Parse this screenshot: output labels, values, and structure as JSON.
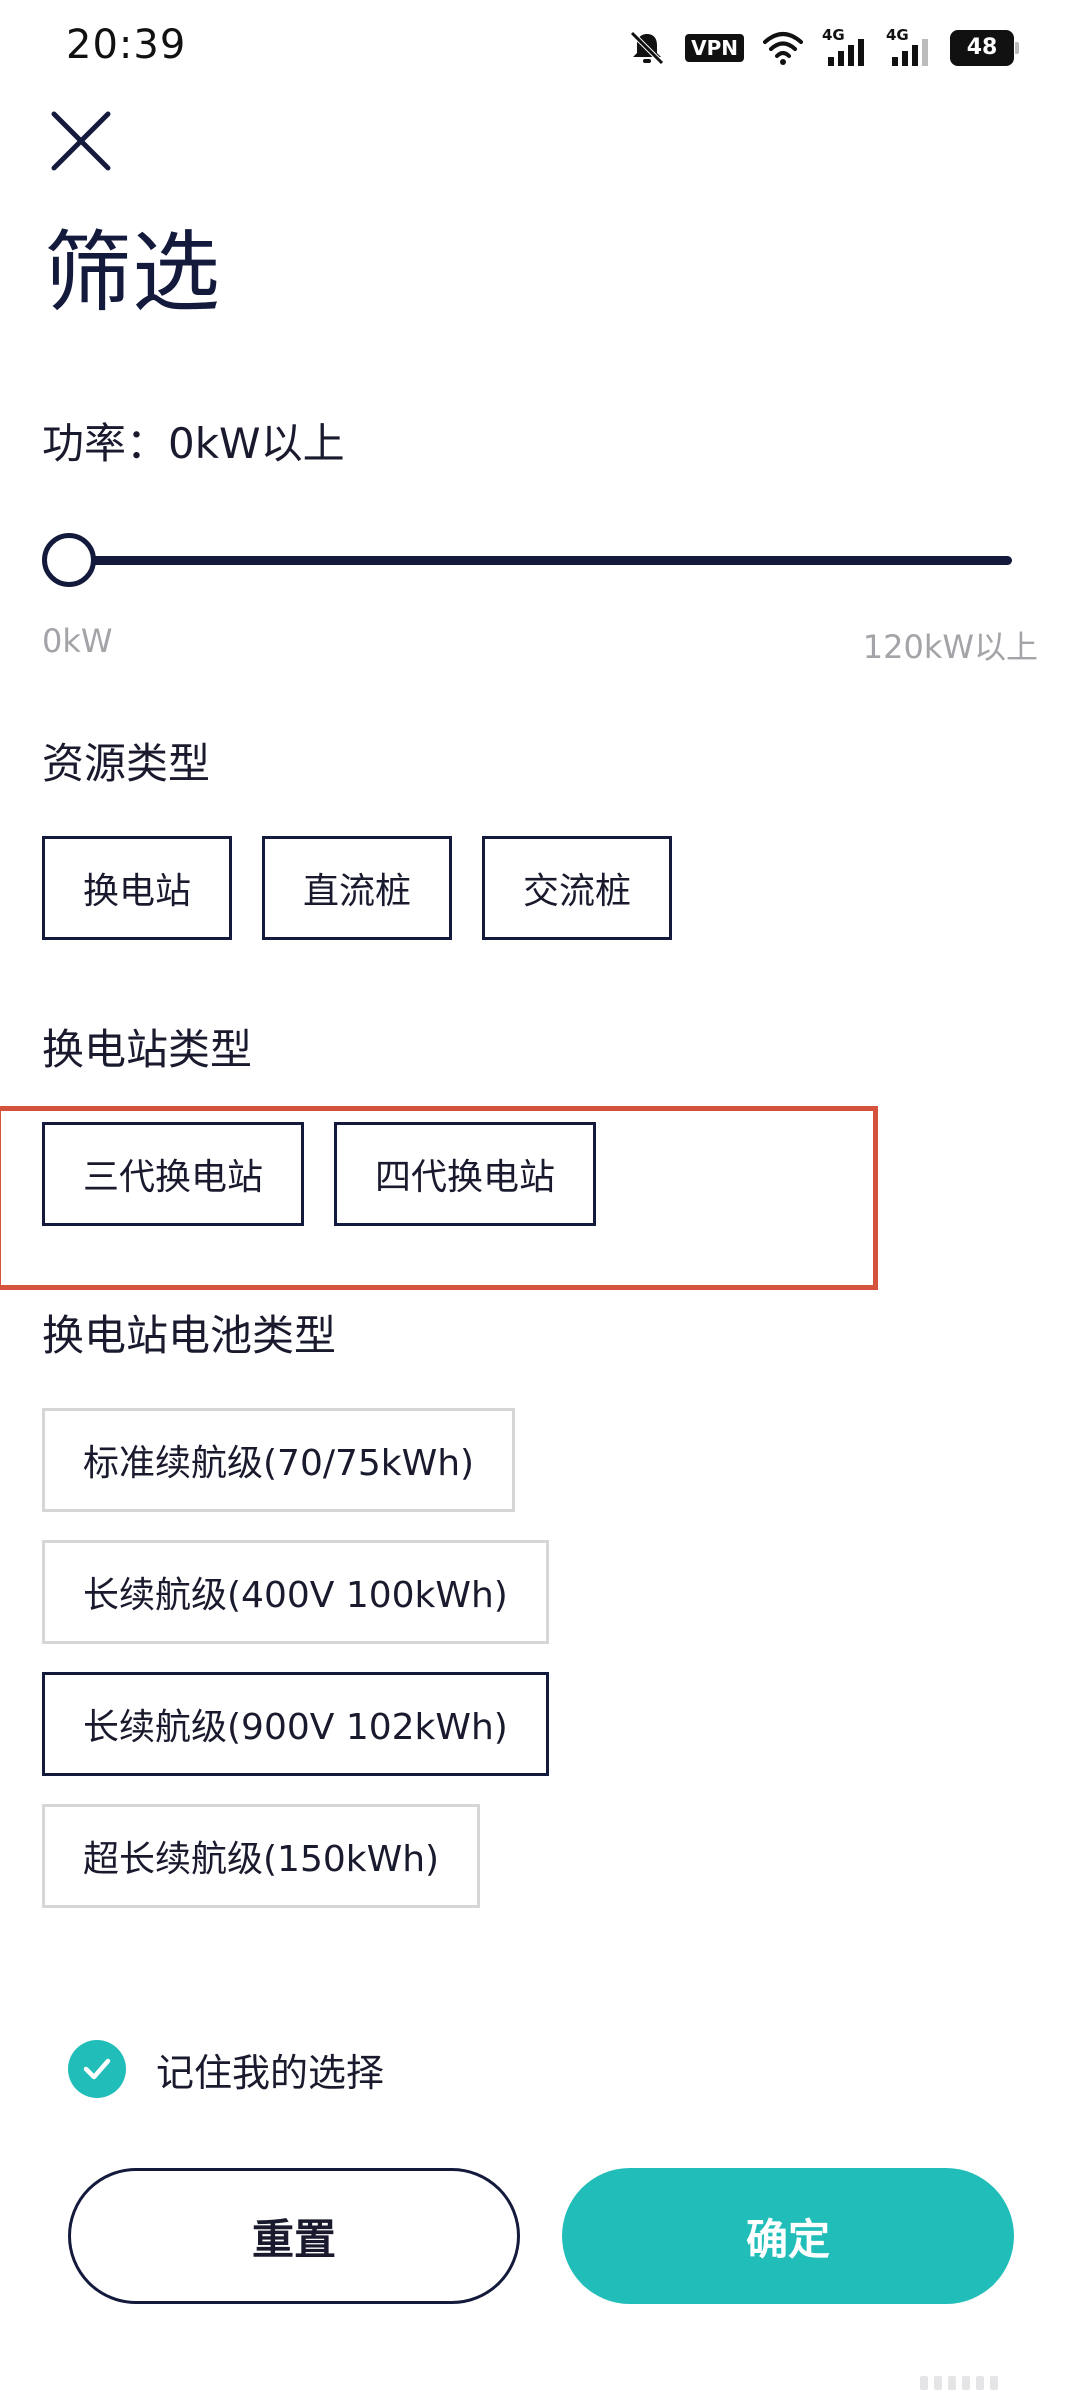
{
  "status_bar": {
    "time": "20:39",
    "icons": [
      "mute-icon",
      "vpn-icon",
      "wifi-icon",
      "signal-4g-icon",
      "signal-4g-icon",
      "battery-icon"
    ],
    "vpn_label": "VPN",
    "network_1": "4G",
    "network_2": "4G",
    "battery_level": "48"
  },
  "header": {
    "close_icon": "close-icon",
    "title": "筛选"
  },
  "power": {
    "label": "功率：0kW以上",
    "slider_value_kw": 0,
    "range_min": "0kW",
    "range_max": "120kW以上"
  },
  "resource_type": {
    "title": "资源类型",
    "options": [
      "换电站",
      "直流桩",
      "交流桩"
    ]
  },
  "station_type": {
    "title": "换电站类型",
    "options": [
      "三代换电站",
      "四代换电站"
    ],
    "highlight_color": "#d5523c"
  },
  "battery_type": {
    "title": "换电站电池类型",
    "options": [
      "标准续航级(70/75kWh)",
      "长续航级(400V 100kWh)",
      "长续航级(900V 102kWh)",
      "超长续航级(150kWh)"
    ],
    "selected": "长续航级(900V 102kWh)"
  },
  "remember": {
    "label": "记住我的选择",
    "checked": true
  },
  "actions": {
    "reset_label": "重置",
    "confirm_label": "确定"
  },
  "colors": {
    "accent": "#20bdb9",
    "primary_dark": "#141a3c",
    "muted_text": "#a3a3a8",
    "light_border": "#d6d6d8"
  }
}
